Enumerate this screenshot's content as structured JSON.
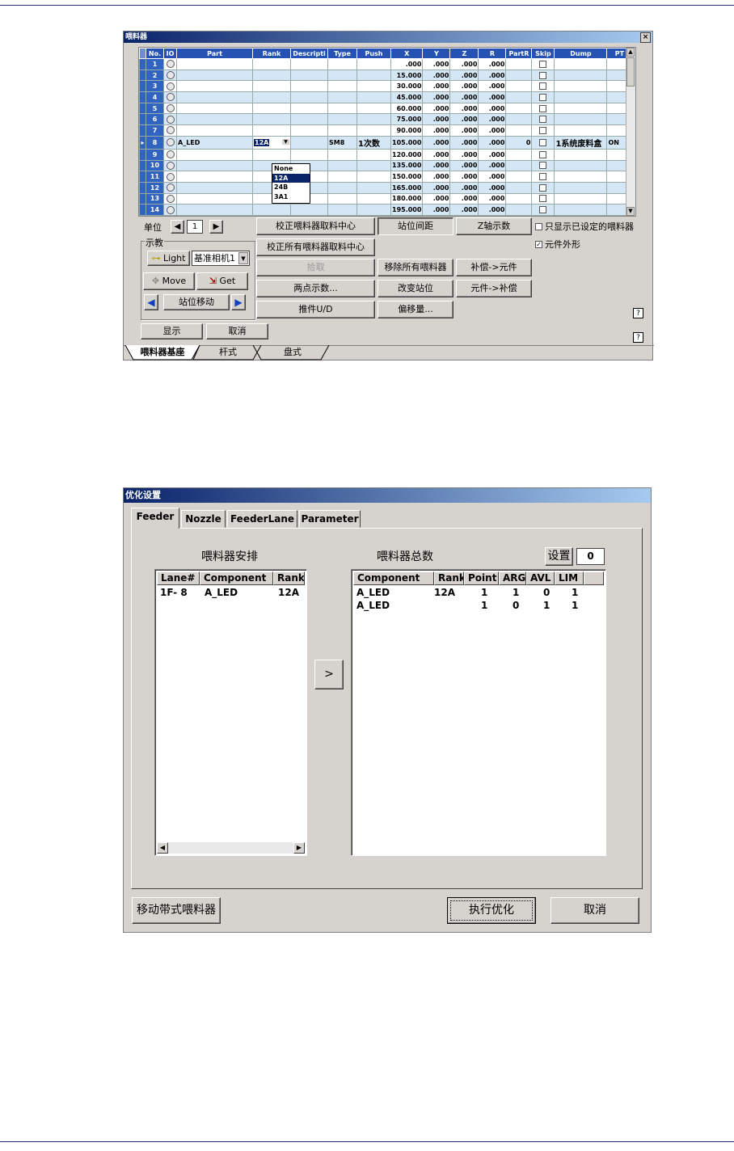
{
  "window1": {
    "title": "喂料器",
    "close": "×",
    "columns": [
      "No.",
      "IO",
      "Part",
      "Rank",
      "Descripti",
      "Type",
      "Push",
      "X",
      "Y",
      "Z",
      "R",
      "PartR",
      "Skip",
      "Dump",
      "PT"
    ],
    "rows": [
      {
        "no": "1",
        "part": "",
        "rank": "",
        "type": "",
        "push": "",
        "x": ".000",
        "y": ".000",
        "z": ".000",
        "r": ".000",
        "partr": "",
        "dump": "",
        "pt": ""
      },
      {
        "no": "2",
        "part": "",
        "rank": "",
        "type": "",
        "push": "",
        "x": "15.000",
        "y": ".000",
        "z": ".000",
        "r": ".000",
        "partr": "",
        "dump": "",
        "pt": ""
      },
      {
        "no": "3",
        "part": "",
        "rank": "",
        "type": "",
        "push": "",
        "x": "30.000",
        "y": ".000",
        "z": ".000",
        "r": ".000",
        "partr": "",
        "dump": "",
        "pt": ""
      },
      {
        "no": "4",
        "part": "",
        "rank": "",
        "type": "",
        "push": "",
        "x": "45.000",
        "y": ".000",
        "z": ".000",
        "r": ".000",
        "partr": "",
        "dump": "",
        "pt": ""
      },
      {
        "no": "5",
        "part": "",
        "rank": "",
        "type": "",
        "push": "",
        "x": "60.000",
        "y": ".000",
        "z": ".000",
        "r": ".000",
        "partr": "",
        "dump": "",
        "pt": ""
      },
      {
        "no": "6",
        "part": "",
        "rank": "",
        "type": "",
        "push": "",
        "x": "75.000",
        "y": ".000",
        "z": ".000",
        "r": ".000",
        "partr": "",
        "dump": "",
        "pt": ""
      },
      {
        "no": "7",
        "part": "",
        "rank": "",
        "type": "",
        "push": "",
        "x": "90.000",
        "y": ".000",
        "z": ".000",
        "r": ".000",
        "partr": "",
        "dump": "",
        "pt": ""
      },
      {
        "no": "8",
        "part": "A_LED",
        "rank": "12A",
        "type": "SM8",
        "push": "1次数",
        "x": "105.000",
        "y": ".000",
        "z": ".000",
        "r": ".000",
        "partr": "0",
        "dump": "1系统废料盒",
        "pt": "ON"
      },
      {
        "no": "9",
        "part": "",
        "rank": "",
        "type": "",
        "push": "",
        "x": "120.000",
        "y": ".000",
        "z": ".000",
        "r": ".000",
        "partr": "",
        "dump": "",
        "pt": ""
      },
      {
        "no": "10",
        "part": "",
        "rank": "",
        "type": "",
        "push": "",
        "x": "135.000",
        "y": ".000",
        "z": ".000",
        "r": ".000",
        "partr": "",
        "dump": "",
        "pt": ""
      },
      {
        "no": "11",
        "part": "",
        "rank": "",
        "type": "",
        "push": "",
        "x": "150.000",
        "y": ".000",
        "z": ".000",
        "r": ".000",
        "partr": "",
        "dump": "",
        "pt": ""
      },
      {
        "no": "12",
        "part": "",
        "rank": "",
        "type": "",
        "push": "",
        "x": "165.000",
        "y": ".000",
        "z": ".000",
        "r": ".000",
        "partr": "",
        "dump": "",
        "pt": ""
      },
      {
        "no": "13",
        "part": "",
        "rank": "",
        "type": "",
        "push": "",
        "x": "180.000",
        "y": ".000",
        "z": ".000",
        "r": ".000",
        "partr": "",
        "dump": "",
        "pt": ""
      },
      {
        "no": "14",
        "part": "",
        "rank": "",
        "type": "",
        "push": "",
        "x": "195.000",
        "y": ".000",
        "z": ".000",
        "r": ".000",
        "partr": "",
        "dump": "",
        "pt": ""
      }
    ],
    "rank_options": [
      "None",
      "12A",
      "24B",
      "3A1"
    ],
    "rank_selected": "12A",
    "unit_label": "单位",
    "unit_value": "1",
    "teach_group": "示教",
    "light_label": "Light",
    "camera_select": "基准相机1",
    "move_label": "Move",
    "get_label": "Get",
    "station_move": "站位移动",
    "buttons": {
      "calib_center": "校正喂料器取料中心",
      "station_pitch": "站位间距",
      "z_teach": "Z轴示数",
      "calib_all": "校正所有喂料器取料中心",
      "pickup": "拾取",
      "remove_all": "移除所有喂料器",
      "comp_to_part": "补偿->元件",
      "two_point": "两点示数...",
      "change_station": "改变站位",
      "part_to_comp": "元件->补偿",
      "pusher_ud": "推件U/D",
      "offset": "偏移量...",
      "display": "显示",
      "cancel": "取消"
    },
    "only_set_feeders": "只显示已设定的喂料器",
    "part_outline": "元件外形",
    "help": "?",
    "tabs": [
      "喂料器基座",
      "杆式",
      "盘式"
    ]
  },
  "window2": {
    "title": "优化设置",
    "tabs": [
      "Feeder",
      "Nozzle",
      "FeederLane",
      "Parameter"
    ],
    "left_title": "喂料器安排",
    "right_title": "喂料器总数",
    "set_label": "设置",
    "set_value": "0",
    "left_headers": [
      "Lane#",
      "Component",
      "Rank"
    ],
    "left_rows": [
      {
        "lane": "1F- 8",
        "component": "A_LED",
        "rank": "12A"
      }
    ],
    "right_headers": [
      "Component",
      "Rank",
      "Point",
      "ARG",
      "AVL",
      "LIM"
    ],
    "right_rows": [
      {
        "component": "A_LED",
        "rank": "12A",
        "point": "1",
        "arg": "1",
        "avl": "0",
        "lim": "1"
      },
      {
        "component": "A_LED",
        "rank": "",
        "point": "1",
        "arg": "0",
        "avl": "1",
        "lim": "1"
      }
    ],
    "move_btn": ">",
    "move_tape_feeder": "移动带式喂料器",
    "run_optimize": "执行优化",
    "cancel": "取消"
  }
}
